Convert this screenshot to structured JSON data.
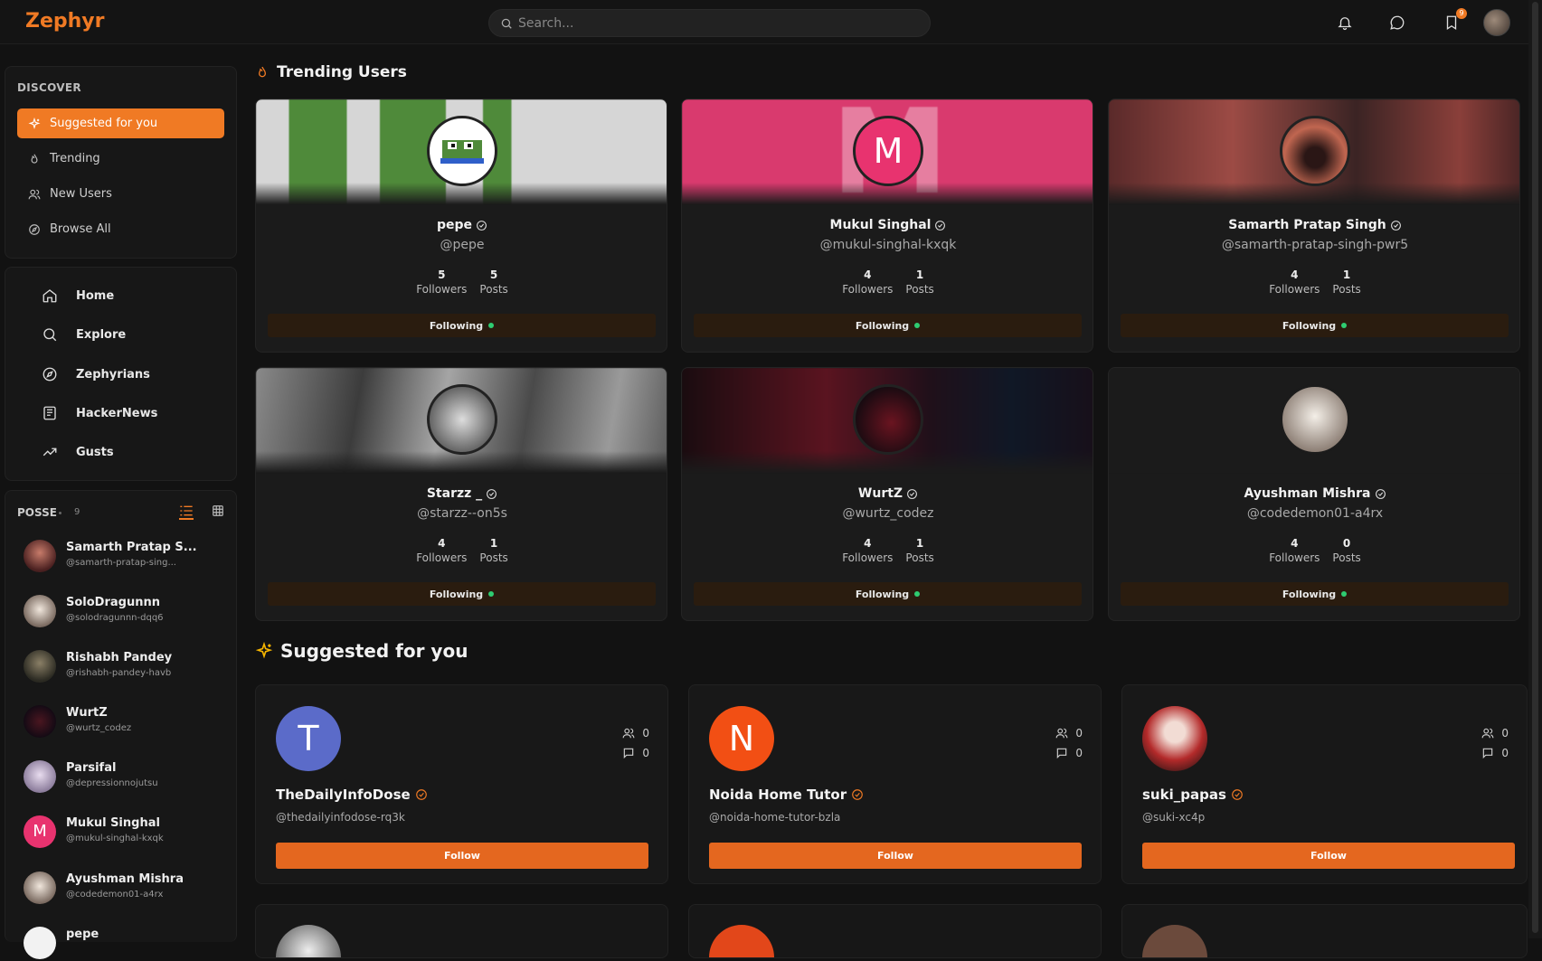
{
  "app": {
    "name": "Zephyr",
    "accent": "#f07a24"
  },
  "search": {
    "placeholder": "Search..."
  },
  "topbar": {
    "notification_badge": "9"
  },
  "discover": {
    "title": "DISCOVER",
    "items": [
      {
        "label": "Suggested for you",
        "icon": "sparkles-icon",
        "active": true
      },
      {
        "label": "Trending",
        "icon": "flame-icon"
      },
      {
        "label": "New Users",
        "icon": "users-icon"
      },
      {
        "label": "Browse All",
        "icon": "compass-icon"
      }
    ]
  },
  "nav": {
    "items": [
      {
        "label": "Home",
        "icon": "home-icon"
      },
      {
        "label": "Explore",
        "icon": "search-icon"
      },
      {
        "label": "Zephyrians",
        "icon": "compass-icon"
      },
      {
        "label": "HackerNews",
        "icon": "newspaper-icon"
      },
      {
        "label": "Gusts",
        "icon": "trending-icon"
      }
    ]
  },
  "posse": {
    "title": "POSSE",
    "count": "9",
    "members": [
      {
        "name": "Samarth Pratap S...",
        "handle": "@samarth-pratap-sing..."
      },
      {
        "name": "SoloDragunnn",
        "handle": "@solodragunnn-dqq6"
      },
      {
        "name": "Rishabh Pandey",
        "handle": "@rishabh-pandey-havb"
      },
      {
        "name": "WurtZ",
        "handle": "@wurtz_codez"
      },
      {
        "name": "Parsifal",
        "handle": "@depressionnojutsu"
      },
      {
        "name": "Mukul Singhal",
        "handle": "@mukul-singhal-kxqk",
        "initial": "M"
      },
      {
        "name": "Ayushman Mishra",
        "handle": "@codedemon01-a4rx"
      },
      {
        "name": "pepe",
        "handle": ""
      }
    ]
  },
  "trending": {
    "title": "Trending Users",
    "followers_label": "Followers",
    "posts_label": "Posts",
    "following_label": "Following",
    "users": [
      {
        "name": "pepe",
        "handle": "@pepe",
        "followers": "5",
        "posts": "5"
      },
      {
        "name": "Mukul Singhal",
        "handle": "@mukul-singhal-kxqk",
        "followers": "4",
        "posts": "1",
        "initial": "M"
      },
      {
        "name": "Samarth Pratap Singh",
        "handle": "@samarth-pratap-singh-pwr5",
        "followers": "4",
        "posts": "1"
      },
      {
        "name": "Starzz _",
        "handle": "@starzz--on5s",
        "followers": "4",
        "posts": "1"
      },
      {
        "name": "WurtZ",
        "handle": "@wurtz_codez",
        "followers": "4",
        "posts": "1"
      },
      {
        "name": "Ayushman Mishra",
        "handle": "@codedemon01-a4rx",
        "followers": "4",
        "posts": "0"
      }
    ]
  },
  "suggested": {
    "title": "Suggested for you",
    "follow_label": "Follow",
    "users": [
      {
        "name": "TheDailyInfoDose",
        "handle": "@thedailyinfodose-rq3k",
        "initial": "T",
        "followers": "0",
        "posts": "0",
        "color": "#5b6bc9"
      },
      {
        "name": "Noida Home Tutor",
        "handle": "@noida-home-tutor-bzla",
        "initial": "N",
        "followers": "0",
        "posts": "0",
        "color": "#f24f14"
      },
      {
        "name": "suki_papas",
        "handle": "@suki-xc4p",
        "initial": "",
        "followers": "0",
        "posts": "0",
        "color": "#5a2b2b"
      }
    ]
  }
}
